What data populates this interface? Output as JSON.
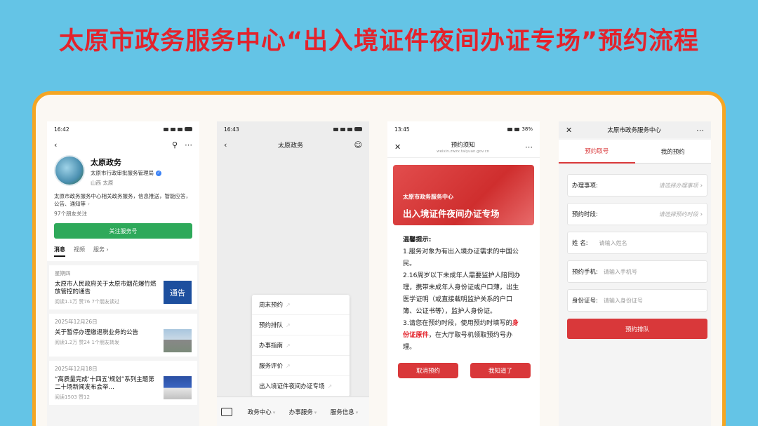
{
  "header": {
    "title": "太原市政务服务中心“出入境证件夜间办证专场”预约流程"
  },
  "phone1": {
    "time": "16:42",
    "account_name": "太原政务",
    "org": "太原市行政审批服务管理局",
    "location": "山西 太原",
    "description": "太原市政务服务中心相关政务服务，信息推送，智能应答，公告、通知等",
    "friends": "97个朋友关注",
    "follow_label": "关注服务号",
    "tabs": [
      "消息",
      "视频",
      "服务"
    ],
    "messages": [
      {
        "date": "星期四",
        "title": "太原市人民政府关于太原市烟花爆竹燃放管控的通告",
        "meta": "阅读1.1万  赞76  7个朋友读过",
        "thumb": "通告"
      },
      {
        "date": "2025年12月26日",
        "title": "关于暂停办理缴退税业务的公告",
        "meta": "阅读1.2万  赞24  1个朋友转发",
        "thumb": ""
      },
      {
        "date": "2025年12月18日",
        "title": "“高质量完成‘十四五’规划”系列主题第二十场新闻发布会举…",
        "meta": "阅读1503  赞12",
        "thumb": ""
      }
    ]
  },
  "phone2": {
    "time": "16:43",
    "title": "太原政务",
    "menu": [
      "周末预约",
      "预约排队",
      "办事指南",
      "服务评价",
      "出入境证件夜间办证专场"
    ],
    "bottom_nav": [
      "政务中心",
      "办事服务",
      "服务信息"
    ]
  },
  "phone3": {
    "time": "13:45",
    "battery": "38%",
    "title": "预约须知",
    "url": "weixin.zwzx.taiyuan.gov.cn",
    "banner_sub": "太原市政务服务中心",
    "banner_main": "出入境证件夜间办证专场",
    "notice_header": "温馨提示:",
    "notice_1": "1.服务对象为有出入境办证需求的中国公民。",
    "notice_2": "2.16周岁以下未成年人需要监护人陪同办理，携带未成年人身份证或户口薄，出生医学证明（或直接载明监护关系的户口簿、公证书等），监护人身份证。",
    "notice_3a": "3.请您在预约时段，使用预约时填写的",
    "notice_3b": "身份证原件",
    "notice_3c": "，在大厅取号机领取预约号办理。",
    "cancel_label": "取消预约",
    "ok_label": "我知道了"
  },
  "phone4": {
    "title": "太原市政务服务中心",
    "tabs": [
      "预约取号",
      "我的预约"
    ],
    "fields": [
      {
        "label": "办理事项:",
        "placeholder": "请选择办理事项"
      },
      {
        "label": "预约时段:",
        "placeholder": "请选择预约时段"
      },
      {
        "label": "姓 名:",
        "placeholder": "请输入姓名"
      },
      {
        "label": "预约手机:",
        "placeholder": "请输入手机号"
      },
      {
        "label": "身份证号:",
        "placeholder": "请输入身份证号"
      }
    ],
    "submit_label": "预约排队"
  }
}
